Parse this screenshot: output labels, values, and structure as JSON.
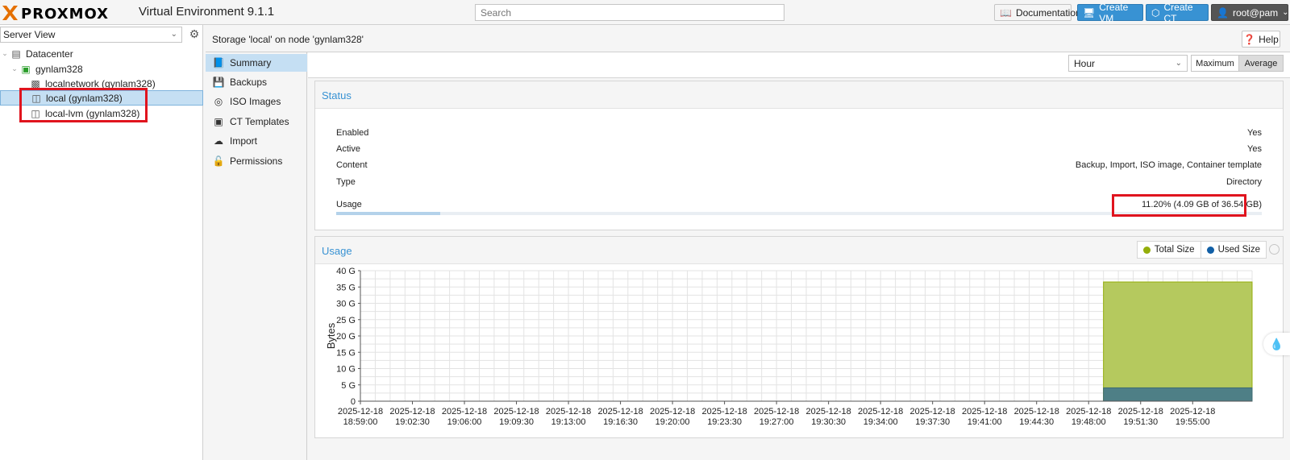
{
  "app": {
    "logo_text": "PROXMOX",
    "version": "Virtual Environment 9.1.1",
    "search_placeholder": "Search",
    "buttons": {
      "documentation": "Documentation",
      "create_vm": "Create VM",
      "create_ct": "Create CT",
      "user": "root@pam"
    }
  },
  "sidebar": {
    "view_select": "Server View",
    "tree": [
      {
        "label": "Datacenter",
        "icon": "datacenter-icon"
      },
      {
        "label": "gynlam328",
        "icon": "node-online-icon"
      },
      {
        "label": "localnetwork (gynlam328)",
        "icon": "network-icon"
      },
      {
        "label": "local (gynlam328)",
        "icon": "storage-icon",
        "selected": true
      },
      {
        "label": "local-lvm (gynlam328)",
        "icon": "storage-icon"
      }
    ]
  },
  "header": {
    "title": "Storage 'local' on node 'gynlam328'",
    "help": "Help"
  },
  "nav": [
    {
      "label": "Summary",
      "icon": "book-icon",
      "active": true
    },
    {
      "label": "Backups",
      "icon": "floppy-icon"
    },
    {
      "label": "ISO Images",
      "icon": "disc-icon"
    },
    {
      "label": "CT Templates",
      "icon": "template-icon"
    },
    {
      "label": "Import",
      "icon": "cloud-upload-icon"
    },
    {
      "label": "Permissions",
      "icon": "unlock-icon"
    }
  ],
  "toolbar": {
    "timeframe": "Hour",
    "maximum": "Maximum",
    "average": "Average"
  },
  "status": {
    "title": "Status",
    "rows": [
      {
        "label": "Enabled",
        "value": "Yes"
      },
      {
        "label": "Active",
        "value": "Yes"
      },
      {
        "label": "Content",
        "value": "Backup, Import, ISO image, Container template"
      },
      {
        "label": "Type",
        "value": "Directory"
      }
    ],
    "usage_label": "Usage",
    "usage_value": "11.20% (4.09 GB of 36.54 GB)",
    "usage_fraction": 0.112
  },
  "usage_chart": {
    "title": "Usage",
    "legend": [
      {
        "name": "Total Size",
        "color": "#94ae0a"
      },
      {
        "name": "Used Size",
        "color": "#115fa6"
      }
    ]
  },
  "chart_data": {
    "type": "area",
    "ylabel": "Bytes",
    "ylim": [
      0,
      40
    ],
    "y_ticks": [
      "0",
      "5 G",
      "10 G",
      "15 G",
      "20 G",
      "25 G",
      "30 G",
      "35 G",
      "40 G"
    ],
    "x_ticks": [
      [
        "2025-12-18",
        "18:59:00"
      ],
      [
        "2025-12-18",
        "19:02:30"
      ],
      [
        "2025-12-18",
        "19:06:00"
      ],
      [
        "2025-12-18",
        "19:09:30"
      ],
      [
        "2025-12-18",
        "19:13:00"
      ],
      [
        "2025-12-18",
        "19:16:30"
      ],
      [
        "2025-12-18",
        "19:20:00"
      ],
      [
        "2025-12-18",
        "19:23:30"
      ],
      [
        "2025-12-18",
        "19:27:00"
      ],
      [
        "2025-12-18",
        "19:30:30"
      ],
      [
        "2025-12-18",
        "19:34:00"
      ],
      [
        "2025-12-18",
        "19:37:30"
      ],
      [
        "2025-12-18",
        "19:41:00"
      ],
      [
        "2025-12-18",
        "19:44:30"
      ],
      [
        "2025-12-18",
        "19:48:00"
      ],
      [
        "2025-12-18",
        "19:51:30"
      ],
      [
        "2025-12-18",
        "19:55:00"
      ]
    ],
    "series": [
      {
        "name": "Total Size",
        "color": "#b5c95e",
        "x_start": "19:49:00",
        "x_end": "19:59:00",
        "value": 36.54
      },
      {
        "name": "Used Size",
        "color": "#4e7f86",
        "x_start": "19:49:00",
        "x_end": "19:59:00",
        "value": 4.09
      }
    ],
    "grid": true
  }
}
